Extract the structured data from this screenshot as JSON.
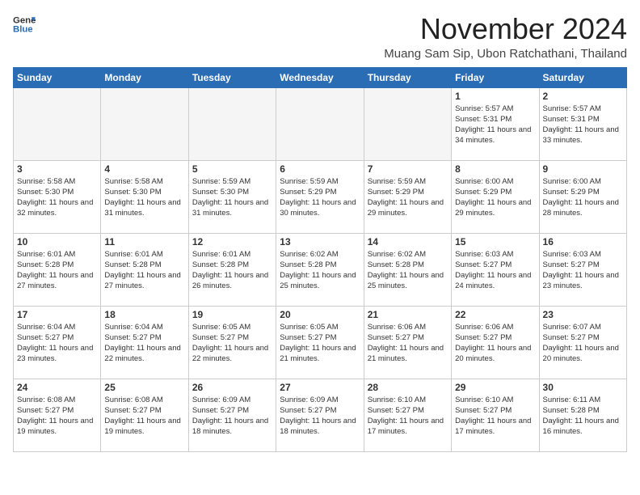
{
  "header": {
    "logo_line1": "General",
    "logo_line2": "Blue",
    "month_title": "November 2024",
    "location": "Muang Sam Sip, Ubon Ratchathani, Thailand"
  },
  "weekdays": [
    "Sunday",
    "Monday",
    "Tuesday",
    "Wednesday",
    "Thursday",
    "Friday",
    "Saturday"
  ],
  "weeks": [
    [
      {
        "day": "",
        "empty": true
      },
      {
        "day": "",
        "empty": true
      },
      {
        "day": "",
        "empty": true
      },
      {
        "day": "",
        "empty": true
      },
      {
        "day": "",
        "empty": true
      },
      {
        "day": "1",
        "sunrise": "Sunrise: 5:57 AM",
        "sunset": "Sunset: 5:31 PM",
        "daylight": "Daylight: 11 hours and 34 minutes."
      },
      {
        "day": "2",
        "sunrise": "Sunrise: 5:57 AM",
        "sunset": "Sunset: 5:31 PM",
        "daylight": "Daylight: 11 hours and 33 minutes."
      }
    ],
    [
      {
        "day": "3",
        "sunrise": "Sunrise: 5:58 AM",
        "sunset": "Sunset: 5:30 PM",
        "daylight": "Daylight: 11 hours and 32 minutes."
      },
      {
        "day": "4",
        "sunrise": "Sunrise: 5:58 AM",
        "sunset": "Sunset: 5:30 PM",
        "daylight": "Daylight: 11 hours and 31 minutes."
      },
      {
        "day": "5",
        "sunrise": "Sunrise: 5:59 AM",
        "sunset": "Sunset: 5:30 PM",
        "daylight": "Daylight: 11 hours and 31 minutes."
      },
      {
        "day": "6",
        "sunrise": "Sunrise: 5:59 AM",
        "sunset": "Sunset: 5:29 PM",
        "daylight": "Daylight: 11 hours and 30 minutes."
      },
      {
        "day": "7",
        "sunrise": "Sunrise: 5:59 AM",
        "sunset": "Sunset: 5:29 PM",
        "daylight": "Daylight: 11 hours and 29 minutes."
      },
      {
        "day": "8",
        "sunrise": "Sunrise: 6:00 AM",
        "sunset": "Sunset: 5:29 PM",
        "daylight": "Daylight: 11 hours and 29 minutes."
      },
      {
        "day": "9",
        "sunrise": "Sunrise: 6:00 AM",
        "sunset": "Sunset: 5:29 PM",
        "daylight": "Daylight: 11 hours and 28 minutes."
      }
    ],
    [
      {
        "day": "10",
        "sunrise": "Sunrise: 6:01 AM",
        "sunset": "Sunset: 5:28 PM",
        "daylight": "Daylight: 11 hours and 27 minutes."
      },
      {
        "day": "11",
        "sunrise": "Sunrise: 6:01 AM",
        "sunset": "Sunset: 5:28 PM",
        "daylight": "Daylight: 11 hours and 27 minutes."
      },
      {
        "day": "12",
        "sunrise": "Sunrise: 6:01 AM",
        "sunset": "Sunset: 5:28 PM",
        "daylight": "Daylight: 11 hours and 26 minutes."
      },
      {
        "day": "13",
        "sunrise": "Sunrise: 6:02 AM",
        "sunset": "Sunset: 5:28 PM",
        "daylight": "Daylight: 11 hours and 25 minutes."
      },
      {
        "day": "14",
        "sunrise": "Sunrise: 6:02 AM",
        "sunset": "Sunset: 5:28 PM",
        "daylight": "Daylight: 11 hours and 25 minutes."
      },
      {
        "day": "15",
        "sunrise": "Sunrise: 6:03 AM",
        "sunset": "Sunset: 5:27 PM",
        "daylight": "Daylight: 11 hours and 24 minutes."
      },
      {
        "day": "16",
        "sunrise": "Sunrise: 6:03 AM",
        "sunset": "Sunset: 5:27 PM",
        "daylight": "Daylight: 11 hours and 23 minutes."
      }
    ],
    [
      {
        "day": "17",
        "sunrise": "Sunrise: 6:04 AM",
        "sunset": "Sunset: 5:27 PM",
        "daylight": "Daylight: 11 hours and 23 minutes."
      },
      {
        "day": "18",
        "sunrise": "Sunrise: 6:04 AM",
        "sunset": "Sunset: 5:27 PM",
        "daylight": "Daylight: 11 hours and 22 minutes."
      },
      {
        "day": "19",
        "sunrise": "Sunrise: 6:05 AM",
        "sunset": "Sunset: 5:27 PM",
        "daylight": "Daylight: 11 hours and 22 minutes."
      },
      {
        "day": "20",
        "sunrise": "Sunrise: 6:05 AM",
        "sunset": "Sunset: 5:27 PM",
        "daylight": "Daylight: 11 hours and 21 minutes."
      },
      {
        "day": "21",
        "sunrise": "Sunrise: 6:06 AM",
        "sunset": "Sunset: 5:27 PM",
        "daylight": "Daylight: 11 hours and 21 minutes."
      },
      {
        "day": "22",
        "sunrise": "Sunrise: 6:06 AM",
        "sunset": "Sunset: 5:27 PM",
        "daylight": "Daylight: 11 hours and 20 minutes."
      },
      {
        "day": "23",
        "sunrise": "Sunrise: 6:07 AM",
        "sunset": "Sunset: 5:27 PM",
        "daylight": "Daylight: 11 hours and 20 minutes."
      }
    ],
    [
      {
        "day": "24",
        "sunrise": "Sunrise: 6:08 AM",
        "sunset": "Sunset: 5:27 PM",
        "daylight": "Daylight: 11 hours and 19 minutes."
      },
      {
        "day": "25",
        "sunrise": "Sunrise: 6:08 AM",
        "sunset": "Sunset: 5:27 PM",
        "daylight": "Daylight: 11 hours and 19 minutes."
      },
      {
        "day": "26",
        "sunrise": "Sunrise: 6:09 AM",
        "sunset": "Sunset: 5:27 PM",
        "daylight": "Daylight: 11 hours and 18 minutes."
      },
      {
        "day": "27",
        "sunrise": "Sunrise: 6:09 AM",
        "sunset": "Sunset: 5:27 PM",
        "daylight": "Daylight: 11 hours and 18 minutes."
      },
      {
        "day": "28",
        "sunrise": "Sunrise: 6:10 AM",
        "sunset": "Sunset: 5:27 PM",
        "daylight": "Daylight: 11 hours and 17 minutes."
      },
      {
        "day": "29",
        "sunrise": "Sunrise: 6:10 AM",
        "sunset": "Sunset: 5:27 PM",
        "daylight": "Daylight: 11 hours and 17 minutes."
      },
      {
        "day": "30",
        "sunrise": "Sunrise: 6:11 AM",
        "sunset": "Sunset: 5:28 PM",
        "daylight": "Daylight: 11 hours and 16 minutes."
      }
    ]
  ]
}
